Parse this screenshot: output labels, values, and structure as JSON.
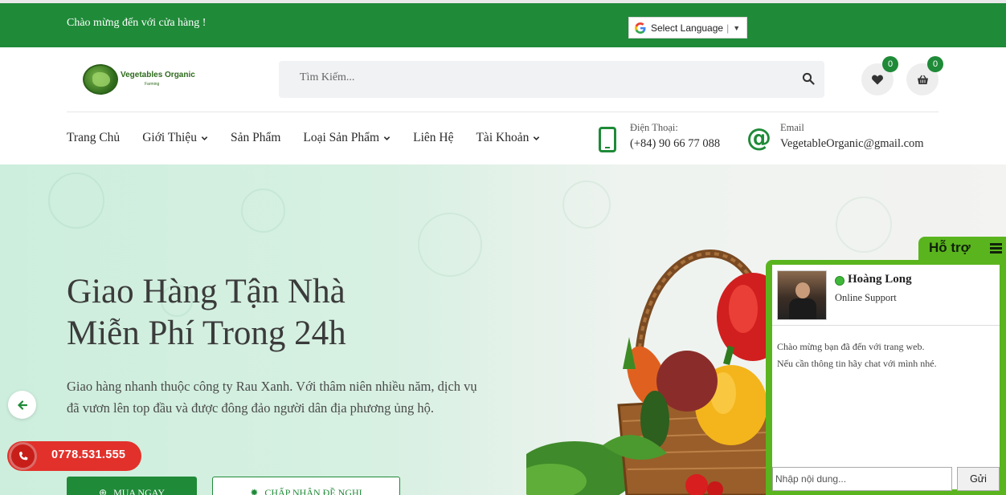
{
  "topbar": {
    "welcome": "Chào mừng đến với cửa hàng !",
    "language_select": "Select Language"
  },
  "header": {
    "logo_title": "Vegetables Organic",
    "logo_subtitle": "Farming",
    "search_placeholder": "Tìm Kiếm...",
    "wishlist_count": "0",
    "cart_count": "0"
  },
  "nav": {
    "items": [
      {
        "label": "Trang Chủ",
        "dropdown": false
      },
      {
        "label": "Giới Thiệu",
        "dropdown": true
      },
      {
        "label": "Sản Phẩm",
        "dropdown": false
      },
      {
        "label": "Loại Sản Phẩm",
        "dropdown": true
      },
      {
        "label": "Liên Hệ",
        "dropdown": false
      },
      {
        "label": "Tài Khoản",
        "dropdown": true
      }
    ],
    "phone_label": "Điện Thoại:",
    "phone_value": "(+84) 90 66 77 088",
    "email_label": "Email",
    "email_value": "VegetableOrganic@gmail.com"
  },
  "hero": {
    "title_line1": "Giao Hàng Tận Nhà",
    "title_line2": "Miễn Phí Trong 24h",
    "description": "Giao hàng nhanh thuộc công ty Rau Xanh. Với thâm niên nhiều năm, dịch vụ đã vươn lên top đầu và được đông đảo người dân địa phương ủng hộ.",
    "primary_button": "MUA NGAY",
    "secondary_button": "CHẤP NHẬN ĐỀ NGHỊ"
  },
  "floating": {
    "hotline": "0778.531.555"
  },
  "support": {
    "tab_title": "Hỗ trợ",
    "agent_name": "Hoàng Long",
    "agent_role": "Online Support",
    "welcome_line1": "Chào mừng bạn đã đến với trang web.",
    "welcome_line2": "Nếu cần thông tin hãy chat với mình nhé.",
    "input_placeholder": "Nhập nội dung...",
    "send_label": "Gửi"
  },
  "colors": {
    "brand_green": "#1f8a38",
    "support_green": "#5ab41e",
    "hotline_red": "#e2312b"
  }
}
